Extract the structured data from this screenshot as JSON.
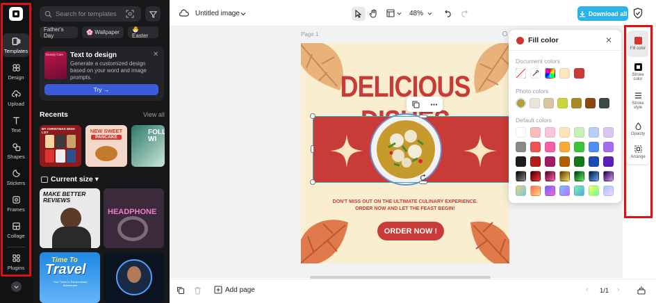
{
  "rail": {
    "items": [
      {
        "label": "Templates",
        "icon": "templates-icon"
      },
      {
        "label": "Design",
        "icon": "design-icon"
      },
      {
        "label": "Upload",
        "icon": "upload-icon"
      },
      {
        "label": "Text",
        "icon": "text-icon"
      },
      {
        "label": "Shapes",
        "icon": "shapes-icon"
      },
      {
        "label": "Stickers",
        "icon": "stickers-icon"
      },
      {
        "label": "Frames",
        "icon": "frames-icon"
      },
      {
        "label": "Collage",
        "icon": "collage-icon"
      },
      {
        "label": "Plugins",
        "icon": "plugins-icon"
      }
    ]
  },
  "panel": {
    "search_placeholder": "Search for templates",
    "chips": [
      "Father's Day",
      "🌸 Wallpaper",
      "🐣 Easter"
    ],
    "promo": {
      "title": "Text to design",
      "description": "Generate a customized design based on your word and image prompts.",
      "button": "Try →",
      "thumb_text": "Beauty Care"
    },
    "recents_title": "Recents",
    "view_all": "View all",
    "recents": [
      {
        "line1": "MY CHRISTMAS WISH LIST"
      },
      {
        "line1": "NEW SWEET",
        "line2": "PANCAKE"
      },
      {
        "line1": "FOLLO",
        "line2": "WI"
      }
    ],
    "current_size_title": "Current size",
    "grid": [
      {
        "line1": "MAKE BETTER",
        "line2": "REVIEWS"
      },
      {
        "line1": "HEADPHONE"
      },
      {
        "line1": "Time To",
        "line2": "Travel",
        "line3": "Your Ticket to Extraordinary Adventures"
      },
      {
        "line1": ""
      }
    ]
  },
  "topbar": {
    "title": "Untitled image",
    "zoom": "48%",
    "download_label": "Download all"
  },
  "canvas": {
    "page_label": "Page 1",
    "poster": {
      "title": "DELICIOUS DISHES",
      "tagline1": "DON'T MISS OUT ON THE ULTIMATE CULINARY EXPERIENCE.",
      "tagline2": "ORDER NOW AND LET THE FEAST BEGIN!",
      "button": "ORDER NOW !"
    }
  },
  "fill_popup": {
    "title": "Fill color",
    "document_label": "Document colors",
    "document_colors": [
      "#ffffff",
      "picker",
      "rainbow",
      "#fde7bd",
      "#c93b36"
    ],
    "photo_label": "Photo colors",
    "photo_colors": [
      "photo",
      "#e9e5da",
      "#d8c79f",
      "#cdd33c",
      "#a88a25",
      "#8e4714",
      "#3c4a44"
    ],
    "default_label": "Default colors",
    "default_colors": [
      [
        "#ffffff",
        "#f8bcbc",
        "#fbc4dd",
        "#fde5b7",
        "#c8f0b9",
        "#b6cff7",
        "#d7c7f4"
      ],
      [
        "#8a8a8a",
        "#ed5553",
        "#f45fa6",
        "#fca73a",
        "#3ec23c",
        "#4d8ef0",
        "#a46df0"
      ],
      [
        "#1c1c1c",
        "#b41b1b",
        "#a01d66",
        "#b35e00",
        "#15791c",
        "#1b4cb5",
        "#5b21b6"
      ],
      [
        "grad-dark",
        "grad-red",
        "grad-pink",
        "grad-orange",
        "grad-green",
        "grad-blue",
        "grad-purple"
      ],
      [
        "grad-rainbow1",
        "grad-rainbow2",
        "grad-rainbow3",
        "grad-rainbow4",
        "grad-rainbow5",
        "grad-rainbow6",
        "grad-rainbow7"
      ]
    ]
  },
  "right_rail": {
    "items": [
      {
        "label": "Fill color"
      },
      {
        "label": "Stroke color"
      },
      {
        "label": "Stroke style"
      },
      {
        "label": "Opacity"
      },
      {
        "label": "Arrange"
      }
    ]
  },
  "bottombar": {
    "add_page": "Add page",
    "page_count": "1/1"
  }
}
